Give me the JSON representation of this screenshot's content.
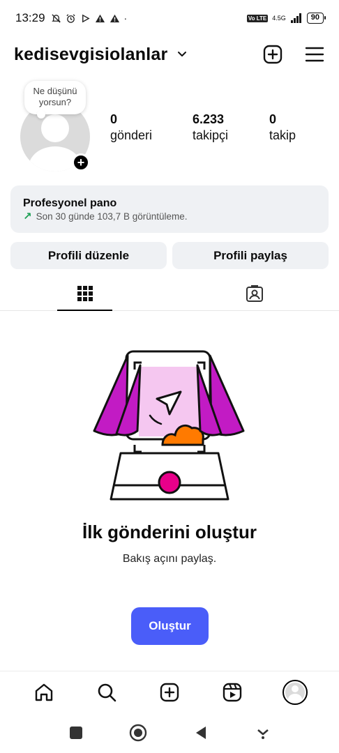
{
  "status_bar": {
    "time": "13:29",
    "network": "4.5G",
    "volte": "Vo LTE",
    "battery": "90"
  },
  "header": {
    "username": "kedisevgisiolanlar"
  },
  "profile": {
    "note_prompt": "Ne düşünü yorsun?",
    "stats": [
      {
        "value": "0",
        "label": "gönderi"
      },
      {
        "value": "6.233",
        "label": "takipçi"
      },
      {
        "value": "0",
        "label": "takip"
      }
    ]
  },
  "dashboard": {
    "title": "Profesyonel pano",
    "subtitle": "Son 30 günde 103,7 B görüntüleme."
  },
  "actions": {
    "edit_profile": "Profili düzenle",
    "share_profile": "Profili paylaş"
  },
  "empty_state": {
    "title": "İlk gönderini oluştur",
    "subtitle": "Bakış açını paylaş.",
    "create_button": "Oluştur"
  },
  "colors": {
    "accent": "#4a5df9",
    "magenta": "#c21bc4",
    "orange": "#ff7a00",
    "pink_dot": "#e8008a",
    "growth": "#1a9e52"
  },
  "icons": {
    "header": [
      "chevron-down-icon",
      "plus-square-icon",
      "menu-icon"
    ],
    "tabs": [
      "grid-icon",
      "tagged-icon"
    ],
    "bottom_nav": [
      "home-icon",
      "search-icon",
      "create-icon",
      "reels-icon",
      "profile-avatar"
    ]
  }
}
